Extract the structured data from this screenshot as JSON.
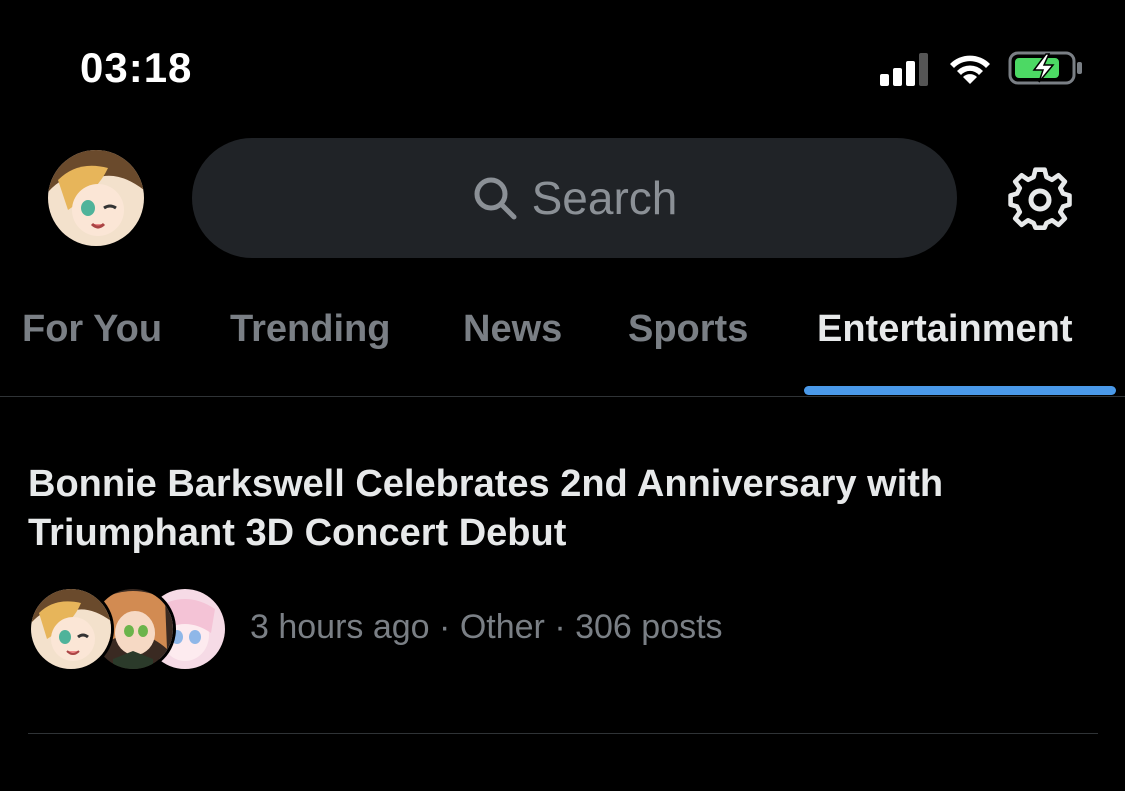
{
  "status_bar": {
    "time": "03:18",
    "icons": [
      "signal-icon",
      "wifi-icon",
      "battery-charging-icon"
    ],
    "battery_color": "#4cd964"
  },
  "header": {
    "avatar_icon": "profile-avatar",
    "search_placeholder": "Search",
    "search_icon": "search-icon",
    "settings_icon": "gear-icon"
  },
  "tabs": [
    {
      "label": "For You",
      "active": false
    },
    {
      "label": "Trending",
      "active": false
    },
    {
      "label": "News",
      "active": false
    },
    {
      "label": "Sports",
      "active": false
    },
    {
      "label": "Entertainment",
      "active": true
    }
  ],
  "accent_color": "#4a99e9",
  "trends": [
    {
      "headline_line1": "Bonnie Barkswell Celebrates 2nd Anniversary with",
      "headline_line2": "Triumphant 3D Concert Debut",
      "time": "3 hours ago",
      "category": "Other",
      "posts": "306 posts",
      "separator": "·",
      "avatars": [
        "avatar-1",
        "avatar-2",
        "avatar-3"
      ]
    }
  ]
}
